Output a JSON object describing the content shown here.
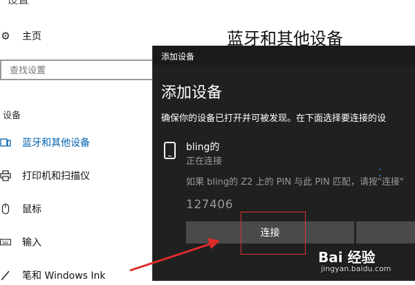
{
  "settings": {
    "top_partial_text": "设置",
    "nav_home": "主页",
    "search_placeholder": "查找设置",
    "section_heading": "设备",
    "nav_items": [
      {
        "label": "蓝牙和其他设备",
        "icon": "bluetooth-devices-icon"
      },
      {
        "label": "打印机和扫描仪",
        "icon": "printer-icon"
      },
      {
        "label": "鼠标",
        "icon": "mouse-icon"
      },
      {
        "label": "输入",
        "icon": "keyboard-icon"
      },
      {
        "label": "笔和 Windows Ink",
        "icon": "pen-icon"
      }
    ],
    "main_title": "蓝牙和其他设备"
  },
  "dialog": {
    "title": "添加设备",
    "heading": "添加设备",
    "description": "确保你的设备已打开并可被发现。在下面选择要连接的设",
    "device_name": "bling的",
    "device_status": "正在连接",
    "pin_message": "如果 bling的 Z2 上的 PIN 与此 PIN 匹配，请按\"连接\"",
    "pin_code": "127406",
    "connect_label": "连接",
    "accent_color": "#0063b1"
  },
  "watermark": {
    "brand": "Bai 经验",
    "url": "jingyan.baidu.com"
  }
}
